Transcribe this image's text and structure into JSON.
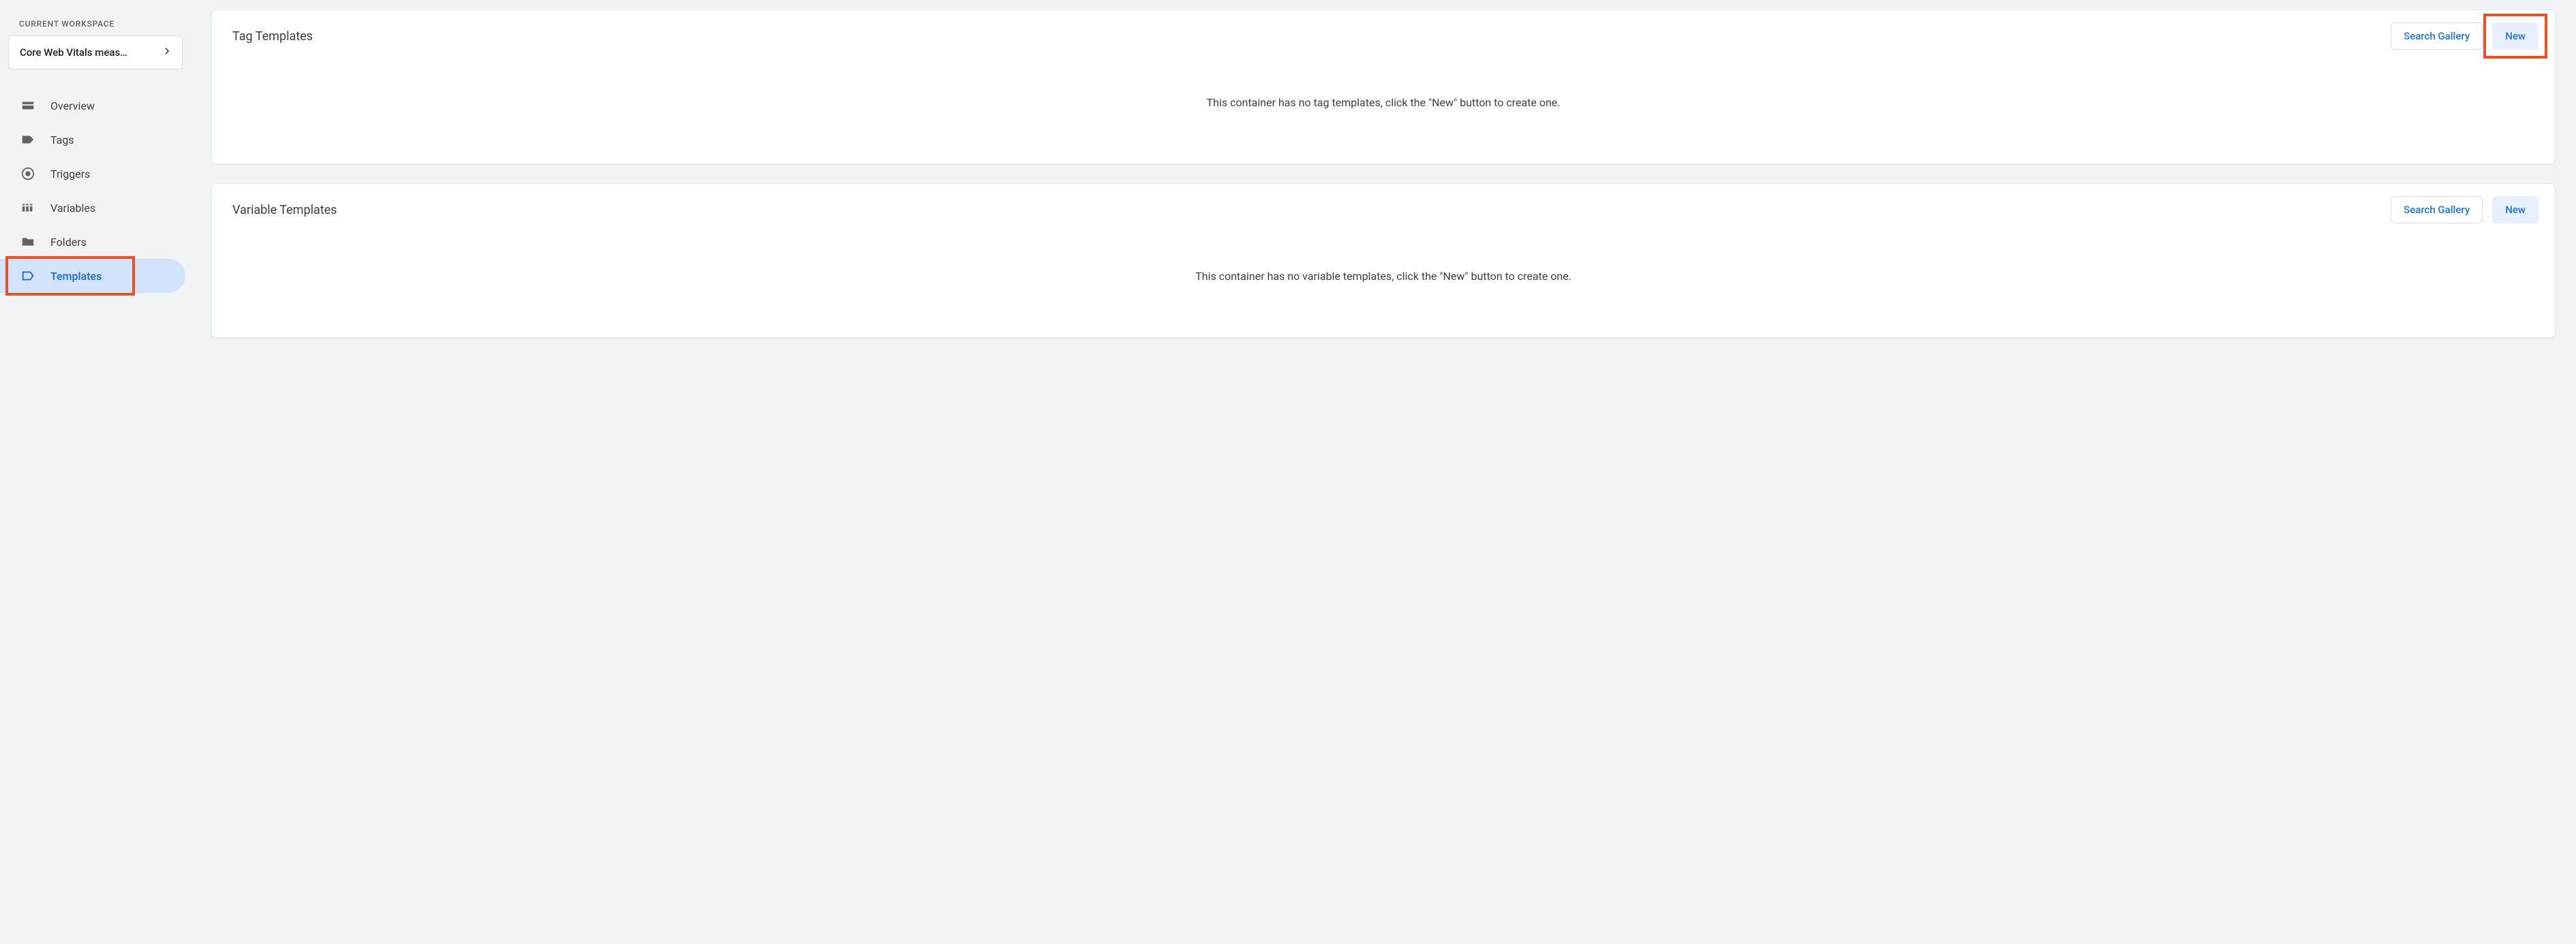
{
  "sidebar": {
    "workspace_label": "CURRENT WORKSPACE",
    "workspace_name": "Core Web Vitals meas…",
    "items": [
      {
        "label": "Overview"
      },
      {
        "label": "Tags"
      },
      {
        "label": "Triggers"
      },
      {
        "label": "Variables"
      },
      {
        "label": "Folders"
      },
      {
        "label": "Templates"
      }
    ]
  },
  "panels": {
    "tag_templates": {
      "title": "Tag Templates",
      "search_label": "Search Gallery",
      "new_label": "New",
      "empty_message": "This container has no tag templates, click the \"New\" button to create one."
    },
    "variable_templates": {
      "title": "Variable Templates",
      "search_label": "Search Gallery",
      "new_label": "New",
      "empty_message": "This container has no variable templates, click the \"New\" button to create one."
    }
  }
}
